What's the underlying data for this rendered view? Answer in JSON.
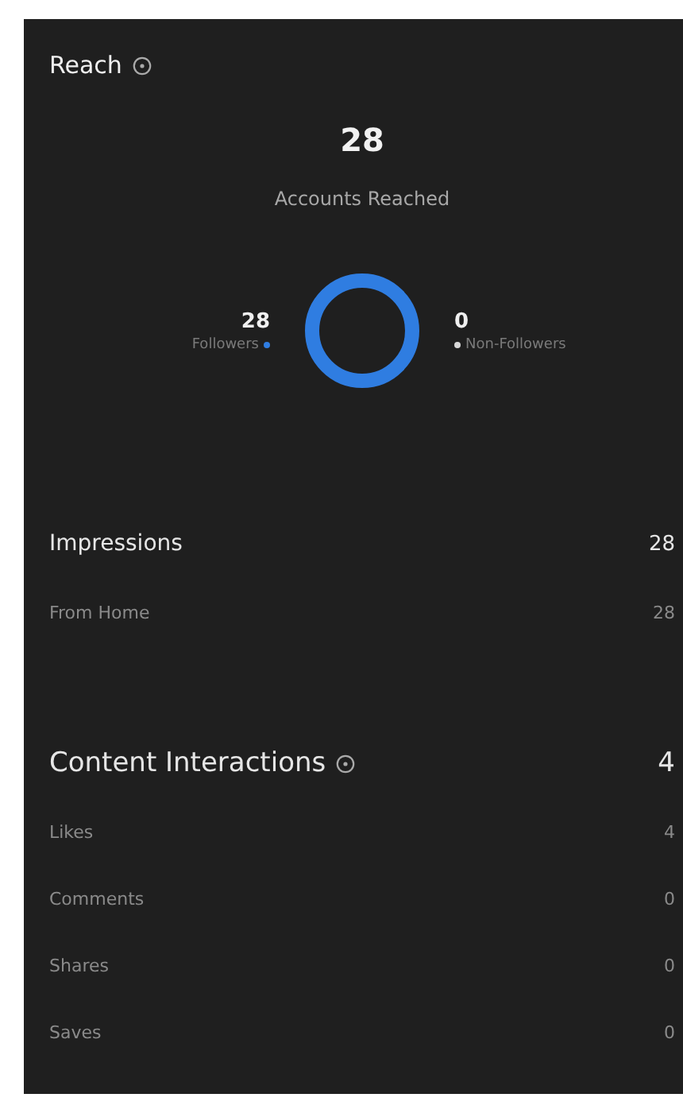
{
  "reach": {
    "title": "Reach",
    "total": "28",
    "total_label": "Accounts Reached",
    "legend": [
      {
        "value": "28",
        "label": "Followers",
        "color": "#2f7de1"
      },
      {
        "value": "0",
        "label": "Non-Followers",
        "color": "#d8d8d8"
      }
    ]
  },
  "impressions": {
    "title": "Impressions",
    "value": "28",
    "rows": [
      {
        "label": "From Home",
        "value": "28"
      }
    ]
  },
  "content_interactions": {
    "title": "Content Interactions",
    "value": "4",
    "rows": [
      {
        "label": "Likes",
        "value": "4"
      },
      {
        "label": "Comments",
        "value": "0"
      },
      {
        "label": "Shares",
        "value": "0"
      },
      {
        "label": "Saves",
        "value": "0"
      }
    ]
  }
}
